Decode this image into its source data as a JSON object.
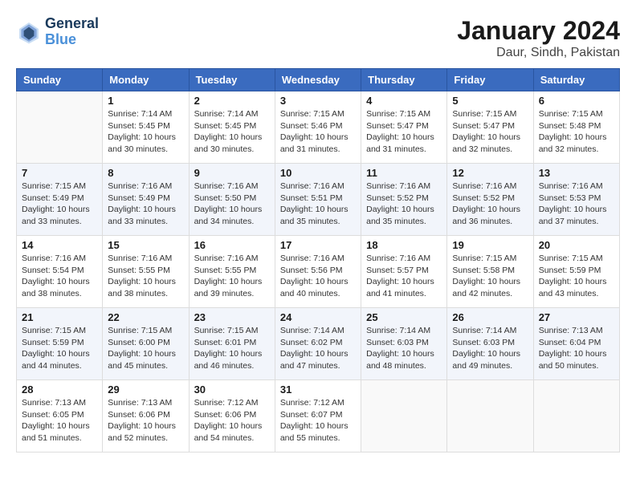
{
  "header": {
    "logo_line1": "General",
    "logo_line2": "Blue",
    "title": "January 2024",
    "subtitle": "Daur, Sindh, Pakistan"
  },
  "weekdays": [
    "Sunday",
    "Monday",
    "Tuesday",
    "Wednesday",
    "Thursday",
    "Friday",
    "Saturday"
  ],
  "weeks": [
    [
      {
        "day": "",
        "info": ""
      },
      {
        "day": "1",
        "info": "Sunrise: 7:14 AM\nSunset: 5:45 PM\nDaylight: 10 hours\nand 30 minutes."
      },
      {
        "day": "2",
        "info": "Sunrise: 7:14 AM\nSunset: 5:45 PM\nDaylight: 10 hours\nand 30 minutes."
      },
      {
        "day": "3",
        "info": "Sunrise: 7:15 AM\nSunset: 5:46 PM\nDaylight: 10 hours\nand 31 minutes."
      },
      {
        "day": "4",
        "info": "Sunrise: 7:15 AM\nSunset: 5:47 PM\nDaylight: 10 hours\nand 31 minutes."
      },
      {
        "day": "5",
        "info": "Sunrise: 7:15 AM\nSunset: 5:47 PM\nDaylight: 10 hours\nand 32 minutes."
      },
      {
        "day": "6",
        "info": "Sunrise: 7:15 AM\nSunset: 5:48 PM\nDaylight: 10 hours\nand 32 minutes."
      }
    ],
    [
      {
        "day": "7",
        "info": "Sunrise: 7:15 AM\nSunset: 5:49 PM\nDaylight: 10 hours\nand 33 minutes."
      },
      {
        "day": "8",
        "info": "Sunrise: 7:16 AM\nSunset: 5:49 PM\nDaylight: 10 hours\nand 33 minutes."
      },
      {
        "day": "9",
        "info": "Sunrise: 7:16 AM\nSunset: 5:50 PM\nDaylight: 10 hours\nand 34 minutes."
      },
      {
        "day": "10",
        "info": "Sunrise: 7:16 AM\nSunset: 5:51 PM\nDaylight: 10 hours\nand 35 minutes."
      },
      {
        "day": "11",
        "info": "Sunrise: 7:16 AM\nSunset: 5:52 PM\nDaylight: 10 hours\nand 35 minutes."
      },
      {
        "day": "12",
        "info": "Sunrise: 7:16 AM\nSunset: 5:52 PM\nDaylight: 10 hours\nand 36 minutes."
      },
      {
        "day": "13",
        "info": "Sunrise: 7:16 AM\nSunset: 5:53 PM\nDaylight: 10 hours\nand 37 minutes."
      }
    ],
    [
      {
        "day": "14",
        "info": "Sunrise: 7:16 AM\nSunset: 5:54 PM\nDaylight: 10 hours\nand 38 minutes."
      },
      {
        "day": "15",
        "info": "Sunrise: 7:16 AM\nSunset: 5:55 PM\nDaylight: 10 hours\nand 38 minutes."
      },
      {
        "day": "16",
        "info": "Sunrise: 7:16 AM\nSunset: 5:55 PM\nDaylight: 10 hours\nand 39 minutes."
      },
      {
        "day": "17",
        "info": "Sunrise: 7:16 AM\nSunset: 5:56 PM\nDaylight: 10 hours\nand 40 minutes."
      },
      {
        "day": "18",
        "info": "Sunrise: 7:16 AM\nSunset: 5:57 PM\nDaylight: 10 hours\nand 41 minutes."
      },
      {
        "day": "19",
        "info": "Sunrise: 7:15 AM\nSunset: 5:58 PM\nDaylight: 10 hours\nand 42 minutes."
      },
      {
        "day": "20",
        "info": "Sunrise: 7:15 AM\nSunset: 5:59 PM\nDaylight: 10 hours\nand 43 minutes."
      }
    ],
    [
      {
        "day": "21",
        "info": "Sunrise: 7:15 AM\nSunset: 5:59 PM\nDaylight: 10 hours\nand 44 minutes."
      },
      {
        "day": "22",
        "info": "Sunrise: 7:15 AM\nSunset: 6:00 PM\nDaylight: 10 hours\nand 45 minutes."
      },
      {
        "day": "23",
        "info": "Sunrise: 7:15 AM\nSunset: 6:01 PM\nDaylight: 10 hours\nand 46 minutes."
      },
      {
        "day": "24",
        "info": "Sunrise: 7:14 AM\nSunset: 6:02 PM\nDaylight: 10 hours\nand 47 minutes."
      },
      {
        "day": "25",
        "info": "Sunrise: 7:14 AM\nSunset: 6:03 PM\nDaylight: 10 hours\nand 48 minutes."
      },
      {
        "day": "26",
        "info": "Sunrise: 7:14 AM\nSunset: 6:03 PM\nDaylight: 10 hours\nand 49 minutes."
      },
      {
        "day": "27",
        "info": "Sunrise: 7:13 AM\nSunset: 6:04 PM\nDaylight: 10 hours\nand 50 minutes."
      }
    ],
    [
      {
        "day": "28",
        "info": "Sunrise: 7:13 AM\nSunset: 6:05 PM\nDaylight: 10 hours\nand 51 minutes."
      },
      {
        "day": "29",
        "info": "Sunrise: 7:13 AM\nSunset: 6:06 PM\nDaylight: 10 hours\nand 52 minutes."
      },
      {
        "day": "30",
        "info": "Sunrise: 7:12 AM\nSunset: 6:06 PM\nDaylight: 10 hours\nand 54 minutes."
      },
      {
        "day": "31",
        "info": "Sunrise: 7:12 AM\nSunset: 6:07 PM\nDaylight: 10 hours\nand 55 minutes."
      },
      {
        "day": "",
        "info": ""
      },
      {
        "day": "",
        "info": ""
      },
      {
        "day": "",
        "info": ""
      }
    ]
  ]
}
